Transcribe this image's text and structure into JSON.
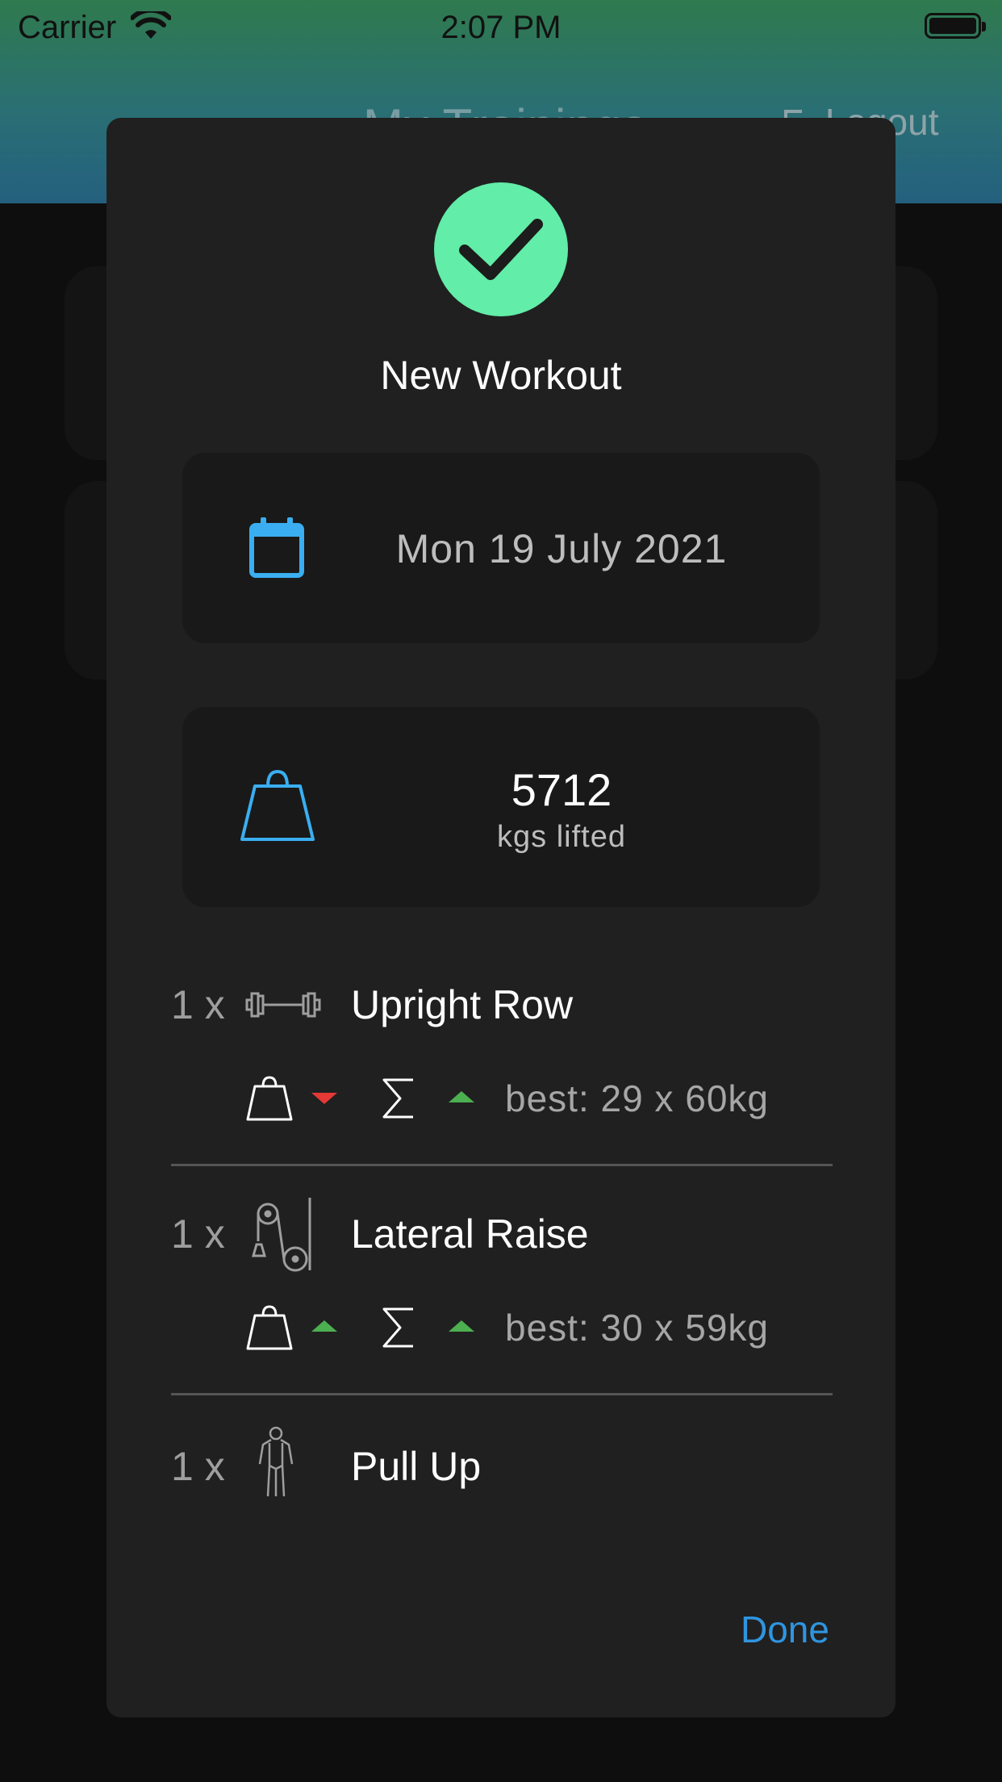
{
  "status_bar": {
    "carrier": "Carrier",
    "time": "2:07 PM"
  },
  "background": {
    "title": "My Trainings",
    "logout": "Logout"
  },
  "modal": {
    "title": "New Workout",
    "date": "Mon 19 July 2021",
    "total_weight": "5712",
    "total_weight_unit": "kgs lifted",
    "exercises": [
      {
        "count": "1 x",
        "name": "Upright Row",
        "icon": "barbell-icon",
        "weight_trend": "down",
        "volume_trend": "up",
        "best": "best: 29 x 60kg"
      },
      {
        "count": "1 x",
        "name": "Lateral Raise",
        "icon": "cable-machine-icon",
        "weight_trend": "up",
        "volume_trend": "up",
        "best": "best: 30 x 59kg"
      },
      {
        "count": "1 x",
        "name": "Pull Up",
        "icon": "bodyweight-icon"
      }
    ],
    "done_label": "Done"
  },
  "colors": {
    "accent_blue": "#2f95e0",
    "success_green": "#62eda8",
    "trend_up": "#4caf50",
    "trend_down": "#e53935"
  }
}
